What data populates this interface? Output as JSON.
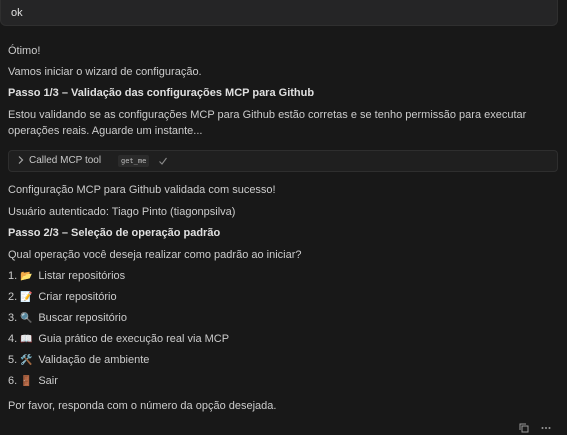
{
  "user_message": "ok",
  "response": {
    "greeting": "Ótimo!",
    "intro": "Vamos iniciar o wizard de configuração.",
    "step1_title": "Passo 1/3 – Validação das configurações MCP para Github",
    "step1_text_line1": "Estou validando se as configurações MCP para Github estão corretas e se tenho permissão para executar",
    "step1_text_line2": "operações reais. Aguarde um instante...",
    "tool_call": {
      "label": "Called MCP tool",
      "tool_name": "get_me"
    },
    "validated": "Configuração MCP para Github validada com sucesso!",
    "user_auth": "Usuário autenticado: Tiago Pinto (tiagonpsilva)",
    "step2_title": "Passo 2/3 – Seleção de operação padrão",
    "question": "Qual operação você deseja realizar como padrão ao iniciar?",
    "options": [
      {
        "number": "1.",
        "emoji": "📂",
        "label": "Listar repositórios"
      },
      {
        "number": "2.",
        "emoji": "📝",
        "label": "Criar repositório"
      },
      {
        "number": "3.",
        "emoji": "🔍",
        "label": "Buscar repositório"
      },
      {
        "number": "4.",
        "emoji": "📖",
        "label": "Guia prático de execução real via MCP"
      },
      {
        "number": "5.",
        "emoji": "🛠️",
        "label": "Validação de ambiente"
      },
      {
        "number": "6.",
        "emoji": "🚪",
        "label": "Sair"
      }
    ],
    "closing": "Por favor, responda com o número da opção desejada."
  },
  "icons": {
    "chevron": "chevron-right-icon",
    "check": "check-icon",
    "copy": "copy-icon",
    "more": "more-icon"
  }
}
